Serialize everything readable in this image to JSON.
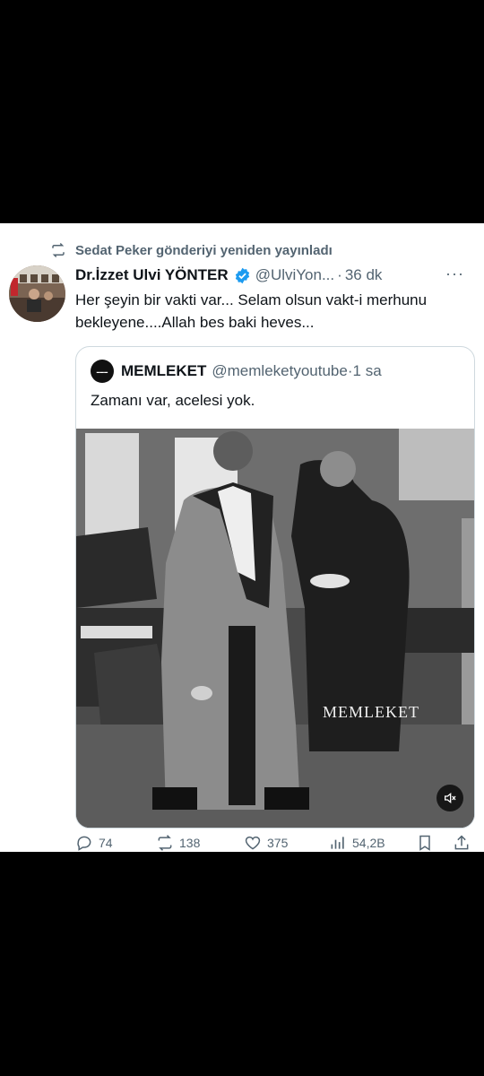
{
  "retweet": {
    "text": "Sedat Peker gönderiyi yeniden yayınladı",
    "icon": "retweet-icon"
  },
  "tweet": {
    "author_name": "Dr.İzzet Ulvi YÖNTER",
    "handle": "@UlviYon...",
    "separator": "·",
    "time": "36 dk",
    "more_label": "···",
    "text": "Her şeyin bir vakti var... Selam olsun vakt-i merhunu bekleyene....Allah bes baki heves..."
  },
  "quote": {
    "author_name": "MEMLEKET",
    "handle": "@memleketyoutube",
    "separator": "·",
    "time": "1 sa",
    "text": "Zamanı var, acelesi yok.",
    "video_watermark": "MEMLEKET"
  },
  "actions": {
    "replies": "74",
    "reposts": "138",
    "likes": "375",
    "views": "54,2B"
  },
  "colors": {
    "card_bg": "#ffffff",
    "page_bg": "#000000",
    "text_primary": "#0f1419",
    "text_secondary": "#536471",
    "verified": "#1d9bf0",
    "border": "#cfd9de"
  }
}
